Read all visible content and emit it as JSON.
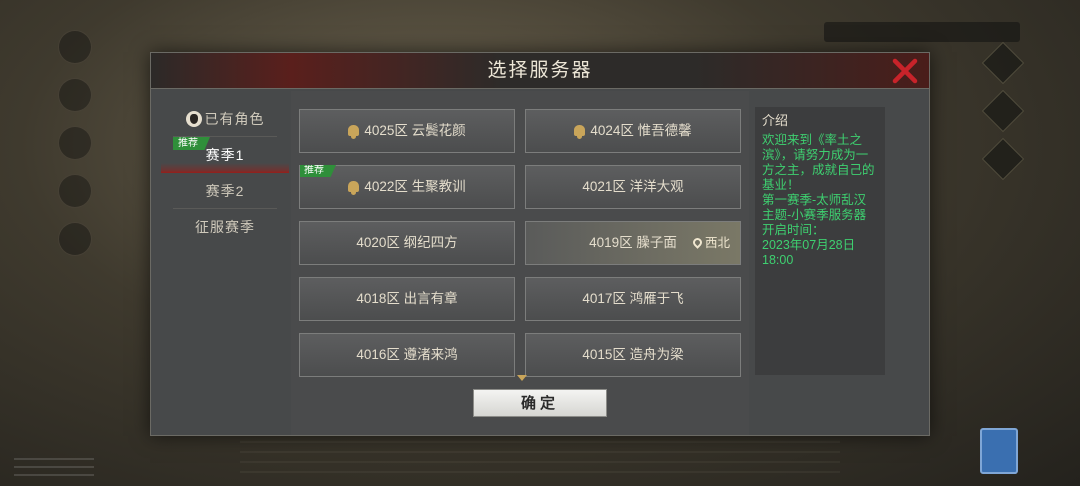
{
  "dialog": {
    "title": "选择服务器",
    "confirm_label": "确定"
  },
  "nav": {
    "items": [
      {
        "label": "已有角色"
      },
      {
        "label": "赛季1",
        "badge": "推荐"
      },
      {
        "label": "赛季2"
      },
      {
        "label": "征服赛季"
      }
    ]
  },
  "servers": [
    {
      "zone": "4025区",
      "name": "云鬓花颜",
      "icon": "bell-icon"
    },
    {
      "zone": "4024区",
      "name": "惟吾德馨",
      "icon": "bell-icon"
    },
    {
      "zone": "4022区",
      "name": "生聚教训",
      "icon": "bell-icon",
      "badge": "推荐"
    },
    {
      "zone": "4021区",
      "name": "洋洋大观"
    },
    {
      "zone": "4020区",
      "name": "纲纪四方"
    },
    {
      "zone": "4019区",
      "name": "臊子面",
      "region": "西北",
      "region_icon": "location-pin-icon"
    },
    {
      "zone": "4018区",
      "name": "出言有章"
    },
    {
      "zone": "4017区",
      "name": "鸿雁于飞"
    },
    {
      "zone": "4016区",
      "name": "遵渚来鸿"
    },
    {
      "zone": "4015区",
      "name": "造舟为梁"
    }
  ],
  "info": {
    "title": "介绍",
    "text": "欢迎来到《率土之滨》，请努力成为一方之主，成就自己的基业！\n第一赛季-太师乱汉主题-小赛季服务器\n开启时间：\n2023年07月28日\n18:00"
  },
  "colors": {
    "accent_red": "#a01914",
    "badge_green": "#2f8f3a",
    "info_text_green": "#3ed070",
    "bell_gold": "#c9a55a"
  }
}
